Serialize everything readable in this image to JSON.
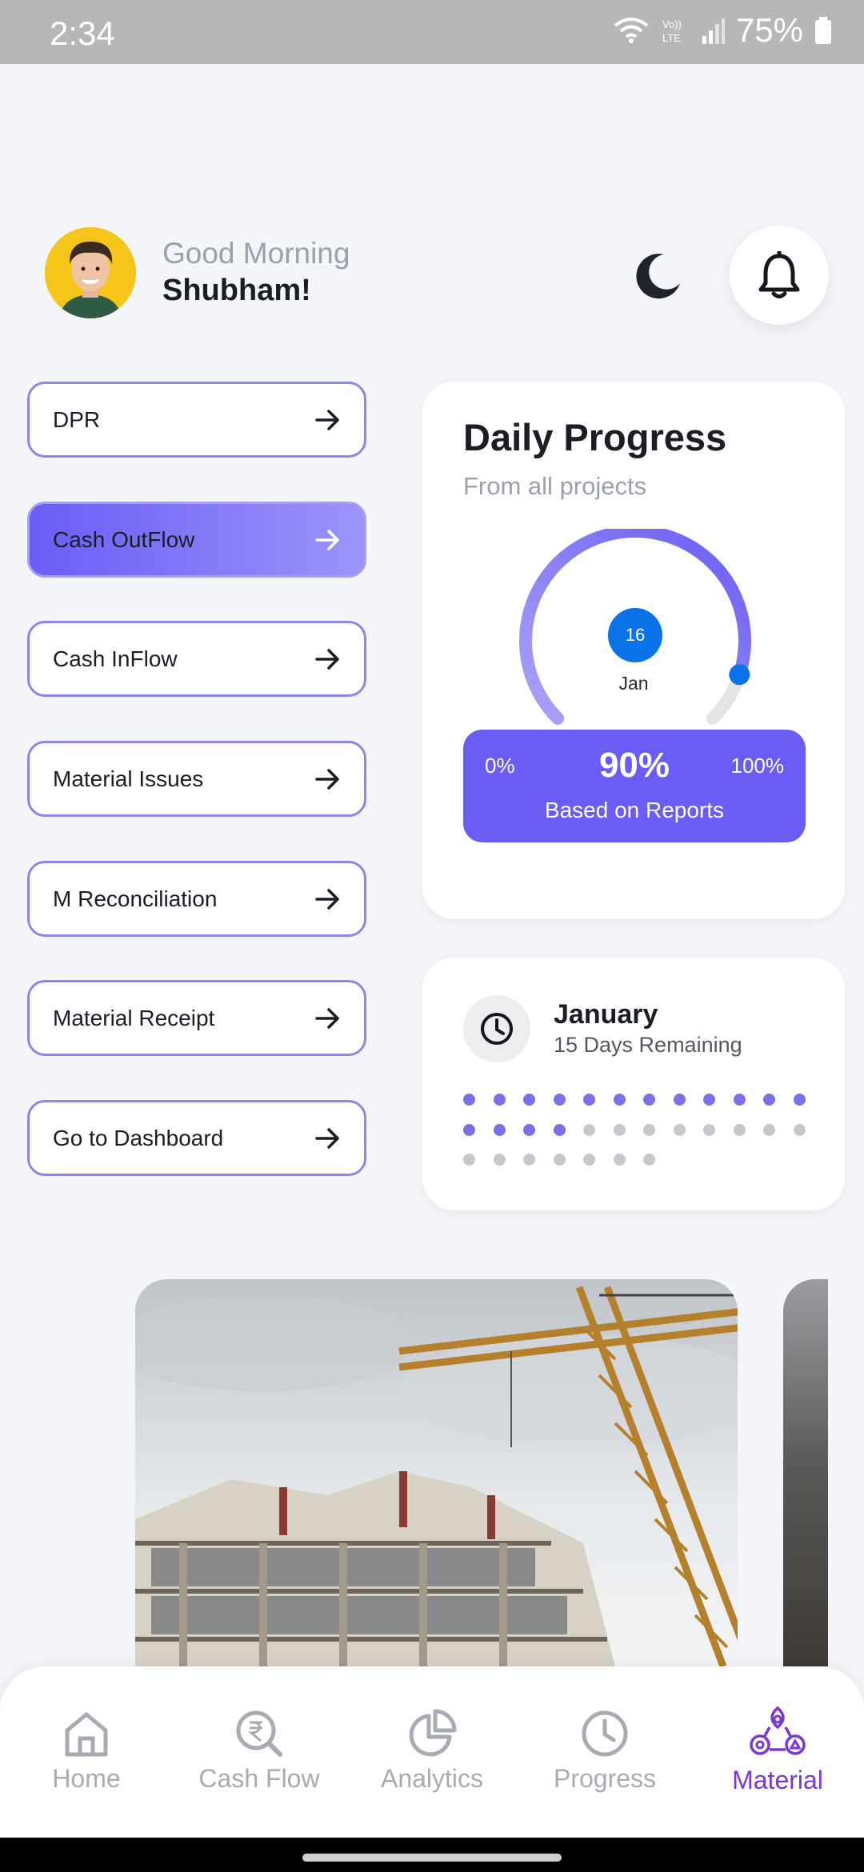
{
  "status_bar": {
    "time": "2:34",
    "battery": "75%"
  },
  "header": {
    "greeting": "Good Morning",
    "user_name": "Shubham!"
  },
  "menu": [
    {
      "label": "DPR",
      "active": false
    },
    {
      "label": "Cash OutFlow",
      "active": true
    },
    {
      "label": "Cash InFlow",
      "active": false
    },
    {
      "label": "Material Issues",
      "active": false
    },
    {
      "label": "M Reconciliation",
      "active": false
    },
    {
      "label": "Material Receipt",
      "active": false
    },
    {
      "label": "Go to Dashboard",
      "active": false
    }
  ],
  "daily_progress": {
    "title": "Daily Progress",
    "subtitle": "From all projects",
    "day": "16",
    "month": "Jan",
    "min_label": "0%",
    "value_label": "90%",
    "max_label": "100%",
    "progress_fraction": 0.9,
    "note": "Based on Reports"
  },
  "month_card": {
    "month": "January",
    "remaining": "15 Days Remaining",
    "total_days": 31,
    "filled_days": 16
  },
  "bottom_nav": [
    {
      "label": "Home",
      "icon": "home-icon",
      "active": false
    },
    {
      "label": "Cash Flow",
      "icon": "rupee-search-icon",
      "active": false
    },
    {
      "label": "Analytics",
      "icon": "pie-chart-icon",
      "active": false
    },
    {
      "label": "Progress",
      "icon": "clock-icon",
      "active": false
    },
    {
      "label": "Material",
      "icon": "material-icon",
      "active": true
    }
  ],
  "colors": {
    "accent": "#6b5cf5",
    "accent_light": "#9c94f8",
    "date_blue": "#0b73ea",
    "nav_active": "#7b37d6",
    "dot_filled": "#7a70ea",
    "dot_empty": "#c6c7cb"
  }
}
